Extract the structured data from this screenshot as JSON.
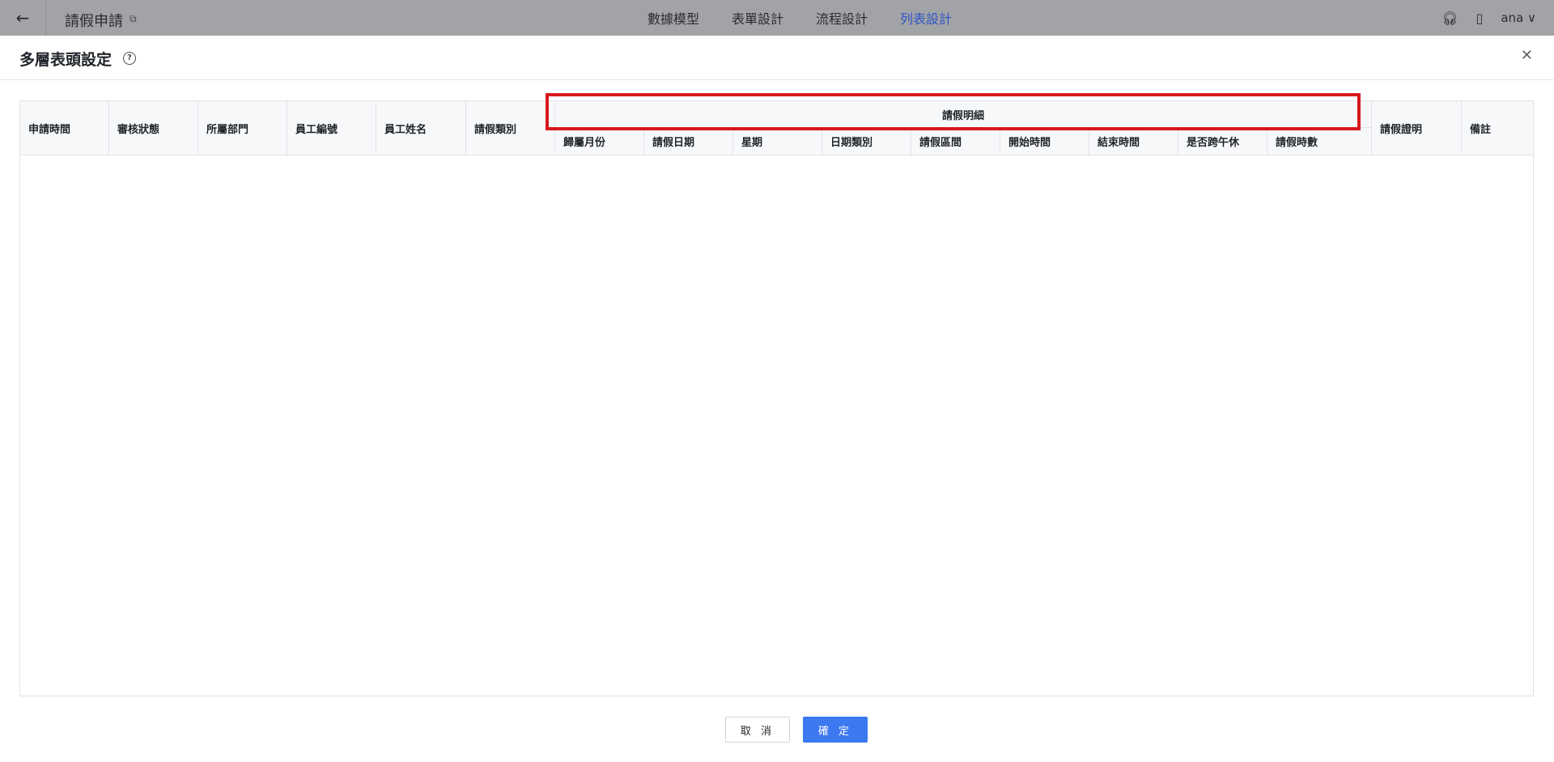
{
  "topbar": {
    "back_icon": "arrow-left-icon",
    "title": "請假申請",
    "external_icon": "external-link-icon",
    "nav": [
      {
        "label": "數據模型",
        "active": false
      },
      {
        "label": "表單設計",
        "active": false
      },
      {
        "label": "流程設計",
        "active": false
      },
      {
        "label": "列表設計",
        "active": true
      }
    ],
    "support_icon": "headset-icon",
    "doc_icon": "document-icon",
    "user": "ana",
    "chevron_icon": "chevron-down-icon"
  },
  "modal": {
    "title": "多層表頭設定",
    "help_icon": "question-circle-icon",
    "close_icon": "close-icon",
    "columns": [
      "申請時間",
      "審核狀態",
      "所屬部門",
      "員工編號",
      "員工姓名",
      "請假類別"
    ],
    "group": {
      "label": "請假明細",
      "children": [
        "歸屬月份",
        "請假日期",
        "星期",
        "日期類別",
        "請假區間",
        "開始時間",
        "結束時間",
        "是否跨午休",
        "請假時數"
      ]
    },
    "trailing_columns": [
      "請假證明",
      "備註"
    ],
    "cancel_label": "取 消",
    "ok_label": "確 定"
  },
  "colors": {
    "accent": "#3c78f0",
    "active_nav": "#2f54c9",
    "highlight": "#d7191d"
  }
}
